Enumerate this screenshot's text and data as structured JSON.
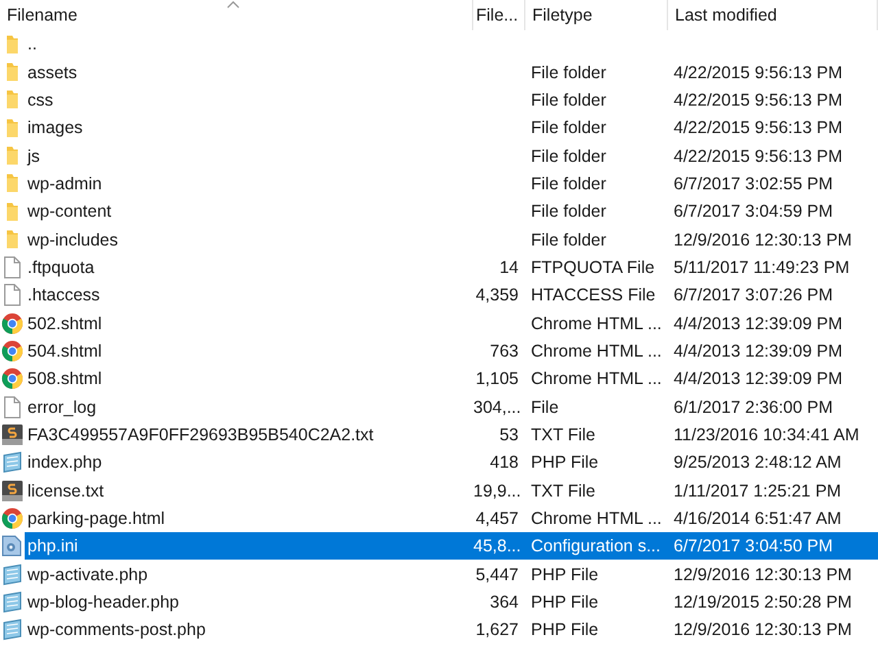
{
  "columns": [
    {
      "label": "Filename",
      "sorted": true
    },
    {
      "label": "File..."
    },
    {
      "label": "Filetype"
    },
    {
      "label": "Last modified"
    }
  ],
  "rows": [
    {
      "kind": "folder",
      "name": "..",
      "selected": false
    },
    {
      "kind": "folder",
      "name": "assets",
      "type": "File folder",
      "modified": "4/22/2015 9:56:13 PM",
      "selected": false
    },
    {
      "kind": "folder",
      "name": "css",
      "type": "File folder",
      "modified": "4/22/2015 9:56:13 PM",
      "selected": false
    },
    {
      "kind": "folder",
      "name": "images",
      "type": "File folder",
      "modified": "4/22/2015 9:56:13 PM",
      "selected": false
    },
    {
      "kind": "folder",
      "name": "js",
      "type": "File folder",
      "modified": "4/22/2015 9:56:13 PM",
      "selected": false
    },
    {
      "kind": "folder",
      "name": "wp-admin",
      "type": "File folder",
      "modified": "6/7/2017 3:02:55 PM",
      "selected": false
    },
    {
      "kind": "folder",
      "name": "wp-content",
      "type": "File folder",
      "modified": "6/7/2017 3:04:59 PM",
      "selected": false
    },
    {
      "kind": "folder",
      "name": "wp-includes",
      "type": "File folder",
      "modified": "12/9/2016 12:30:13 PM",
      "selected": false
    },
    {
      "kind": "file",
      "name": ".ftpquota",
      "size": "14",
      "type": "FTPQUOTA File",
      "modified": "5/11/2017 11:49:23 PM",
      "selected": false
    },
    {
      "kind": "file",
      "name": ".htaccess",
      "size": "4,359",
      "type": "HTACCESS File",
      "modified": "6/7/2017 3:07:26 PM",
      "selected": false
    },
    {
      "kind": "chrome",
      "name": "502.shtml",
      "type": "Chrome HTML ...",
      "modified": "4/4/2013 12:39:09 PM",
      "selected": false
    },
    {
      "kind": "chrome",
      "name": "504.shtml",
      "size": "763",
      "type": "Chrome HTML ...",
      "modified": "4/4/2013 12:39:09 PM",
      "selected": false
    },
    {
      "kind": "chrome",
      "name": "508.shtml",
      "size": "1,105",
      "type": "Chrome HTML ...",
      "modified": "4/4/2013 12:39:09 PM",
      "selected": false
    },
    {
      "kind": "file",
      "name": "error_log",
      "size": "304,...",
      "type": "File",
      "modified": "6/1/2017 2:36:00 PM",
      "selected": false
    },
    {
      "kind": "text",
      "name": "FA3C499557A9F0FF29693B95B540C2A2.txt",
      "size": "53",
      "type": "TXT File",
      "modified": "11/23/2016 10:34:41 AM",
      "selected": false
    },
    {
      "kind": "php",
      "name": "index.php",
      "size": "418",
      "type": "PHP File",
      "modified": "9/25/2013 2:48:12 AM",
      "selected": false
    },
    {
      "kind": "text",
      "name": "license.txt",
      "size": "19,9...",
      "type": "TXT File",
      "modified": "1/11/2017 1:25:21 PM",
      "selected": false
    },
    {
      "kind": "chrome",
      "name": "parking-page.html",
      "size": "4,457",
      "type": "Chrome HTML ...",
      "modified": "4/16/2014 6:51:47 AM",
      "selected": false
    },
    {
      "kind": "config",
      "name": "php.ini",
      "size": "45,8...",
      "type": "Configuration s...",
      "modified": "6/7/2017 3:04:50 PM",
      "selected": true
    },
    {
      "kind": "php",
      "name": "wp-activate.php",
      "size": "5,447",
      "type": "PHP File",
      "modified": "12/9/2016 12:30:13 PM",
      "selected": false
    },
    {
      "kind": "php",
      "name": "wp-blog-header.php",
      "size": "364",
      "type": "PHP File",
      "modified": "12/19/2015 2:50:28 PM",
      "selected": false
    },
    {
      "kind": "php",
      "name": "wp-comments-post.php",
      "size": "1,627",
      "type": "PHP File",
      "modified": "12/9/2016 12:30:13 PM",
      "selected": false
    }
  ]
}
